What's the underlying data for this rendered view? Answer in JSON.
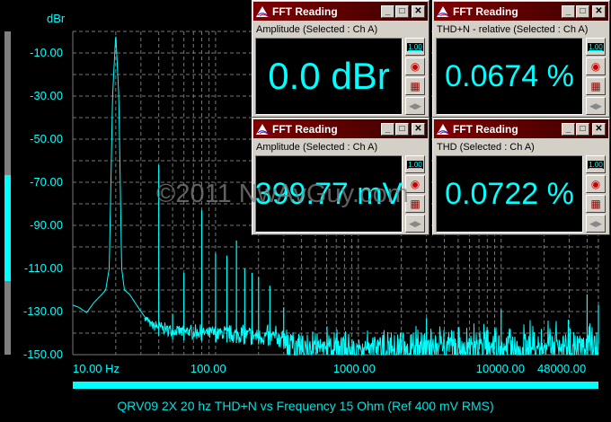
{
  "chart_data": {
    "type": "line",
    "title": "QRV09 2X 20 hz THD+N vs Frequency 15 Ohm (Ref 400 mV RMS)",
    "ylabel": "dBr",
    "xlabel": "",
    "xscale": "log",
    "xlim": [
      10,
      48000
    ],
    "ylim": [
      -150,
      0
    ],
    "y_ticks": [
      "-10.00",
      "-30.00",
      "-50.00",
      "-70.00",
      "-90.00",
      "-110.00",
      "-130.00",
      "-150.00"
    ],
    "y_tick_values": [
      -10,
      -30,
      -50,
      -70,
      -90,
      -110,
      -130,
      -150
    ],
    "x_ticks": [
      "10.00 Hz",
      "100.00",
      "1000.00",
      "10000.00",
      "48000.00"
    ],
    "x_tick_values": [
      10,
      100,
      1000,
      10000,
      48000
    ],
    "grid": true,
    "color": "#00ffff",
    "envelope": [
      [
        10,
        -127
      ],
      [
        11,
        -128
      ],
      [
        12.5,
        -130.5
      ],
      [
        14,
        -126
      ],
      [
        16,
        -122
      ],
      [
        17,
        -120
      ],
      [
        18,
        -110
      ],
      [
        19,
        -30
      ],
      [
        20,
        -1
      ],
      [
        21,
        -30
      ],
      [
        22,
        -110
      ],
      [
        23,
        -120
      ],
      [
        25,
        -122
      ],
      [
        30,
        -130
      ],
      [
        35,
        -136
      ],
      [
        50,
        -139
      ],
      [
        100,
        -140
      ],
      [
        300,
        -142
      ],
      [
        1000,
        -144
      ],
      [
        10000,
        -143
      ],
      [
        40000,
        -142
      ],
      [
        48000,
        -141
      ]
    ],
    "peaks": [
      [
        40,
        -62
      ],
      [
        50,
        -131
      ],
      [
        60,
        -112
      ],
      [
        80,
        -83
      ],
      [
        100,
        -103
      ],
      [
        120,
        -104
      ],
      [
        140,
        -97
      ],
      [
        160,
        -110
      ],
      [
        180,
        -112
      ],
      [
        200,
        -114
      ],
      [
        240,
        -118
      ],
      [
        300,
        -128
      ],
      [
        3000,
        -133
      ],
      [
        10000,
        -129
      ],
      [
        40000,
        -122
      ],
      [
        48000,
        -127
      ]
    ]
  },
  "readings": [
    {
      "title": "FFT Reading",
      "subtitle": "Amplitude (Selected : Ch A)",
      "value": "0.0 dBr"
    },
    {
      "title": "FFT Reading",
      "subtitle": "THD+N - relative (Selected : Ch A)",
      "value": "0.0674 %"
    },
    {
      "title": "FFT Reading",
      "subtitle": "Amplitude (Selected : Ch A)",
      "value": "399.77 mV"
    },
    {
      "title": "FFT Reading",
      "subtitle": "THD (Selected : Ch A)",
      "value": "0.0722 %"
    }
  ],
  "side_buttons": {
    "format": "1.00"
  },
  "watermark": "©2011 NwAvGuy.com"
}
